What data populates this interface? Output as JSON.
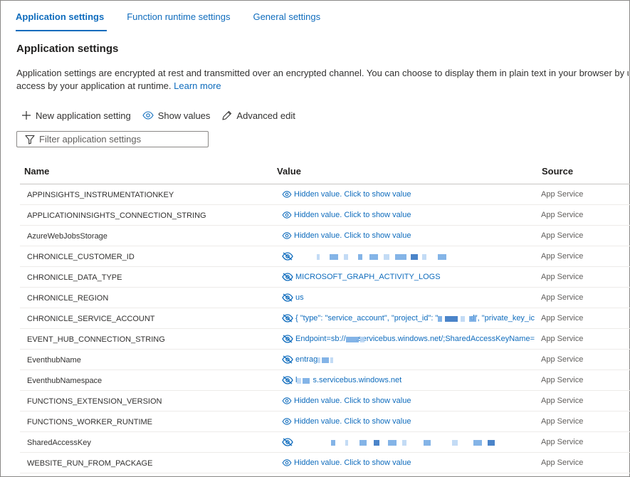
{
  "tabs": [
    {
      "label": "Application settings",
      "active": true
    },
    {
      "label": "Function runtime settings",
      "active": false
    },
    {
      "label": "General settings",
      "active": false
    }
  ],
  "page_title": "Application settings",
  "description": {
    "line1": "Application settings are encrypted at rest and transmitted over an encrypted channel. You can choose to display them in plain text in your browser by using",
    "line2": "access by your application at runtime.",
    "learn_more": "Learn more"
  },
  "toolbar": {
    "new_label": "New application setting",
    "show_label": "Show values",
    "edit_label": "Advanced edit"
  },
  "filter": {
    "placeholder": "Filter application settings",
    "value": ""
  },
  "table": {
    "headers": {
      "name": "Name",
      "value": "Value",
      "source": "Source"
    },
    "rows": [
      {
        "name": "APPINSIGHTS_INSTRUMENTATIONKEY",
        "value": "Hidden value. Click to show value",
        "source": "App Service",
        "hidden": true
      },
      {
        "name": "APPLICATIONINSIGHTS_CONNECTION_STRING",
        "value": "Hidden value. Click to show value",
        "source": "App Service",
        "hidden": true
      },
      {
        "name": "AzureWebJobsStorage",
        "value": "Hidden value. Click to show value",
        "source": "App Service",
        "hidden": true
      },
      {
        "name": "CHRONICLE_CUSTOMER_ID",
        "value": "",
        "source": "App Service",
        "hidden": false
      },
      {
        "name": "CHRONICLE_DATA_TYPE",
        "value": "MICROSOFT_GRAPH_ACTIVITY_LOGS",
        "source": "App Service",
        "hidden": false
      },
      {
        "name": "CHRONICLE_REGION",
        "value": "us",
        "source": "App Service",
        "hidden": false
      },
      {
        "name": "CHRONICLE_SERVICE_ACCOUNT",
        "value_a": "{ \"type\": \"service_account\", \"project_id\": \"",
        "value_b": "d\", \"private_key_ic",
        "source": "App Service",
        "hidden": false
      },
      {
        "name": "EVENT_HUB_CONNECTION_STRING",
        "value_a": "Endpoint=sb://",
        "value_b": ".servicebus.windows.net/;SharedAccessKeyName=",
        "source": "App Service",
        "hidden": false
      },
      {
        "name": "EventhubName",
        "value_a": "entrag",
        "value_b": "",
        "source": "App Service",
        "hidden": false
      },
      {
        "name": "EventhubNamespace",
        "value_a": "l",
        "value_b": "s.servicebus.windows.net",
        "source": "App Service",
        "hidden": false
      },
      {
        "name": "FUNCTIONS_EXTENSION_VERSION",
        "value": "Hidden value. Click to show value",
        "source": "App Service",
        "hidden": true
      },
      {
        "name": "FUNCTIONS_WORKER_RUNTIME",
        "value": "Hidden value. Click to show value",
        "source": "App Service",
        "hidden": true
      },
      {
        "name": "SharedAccessKey",
        "value": "",
        "source": "App Service",
        "hidden": false
      },
      {
        "name": "WEBSITE_RUN_FROM_PACKAGE",
        "value": "Hidden value. Click to show value",
        "source": "App Service",
        "hidden": true
      }
    ]
  },
  "colors": {
    "accent": "#0f6cbd",
    "text": "#323130",
    "border": "#8a8886"
  }
}
